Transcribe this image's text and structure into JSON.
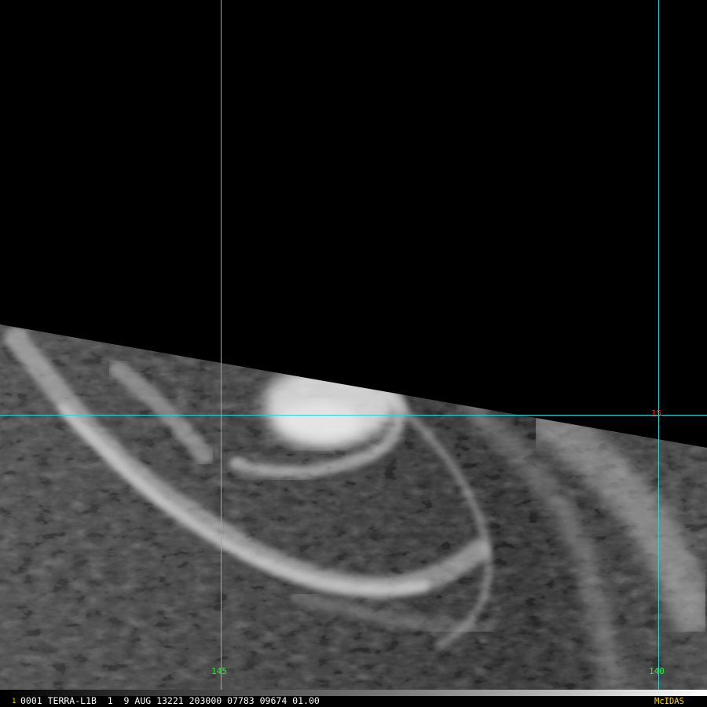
{
  "image": {
    "description_free": true,
    "colors": {
      "background": "#000000",
      "ocean": "#3c3c3c",
      "cloud": "#e6e6e6",
      "grid_line": "#30d0d8",
      "lat_label": "#e23a2a",
      "lon_label": "#2ee82e",
      "status_text": "#ffffff",
      "logo_text": "#ffd800"
    }
  },
  "grid": {
    "lat_label": "15",
    "lon_labels": [
      "145",
      "140"
    ]
  },
  "status_bar": {
    "frame_number": "1",
    "info": "0001 TERRA-L1B  1  9 AUG 13221 203000 07783 09674 01.00",
    "software": "McIDAS"
  }
}
